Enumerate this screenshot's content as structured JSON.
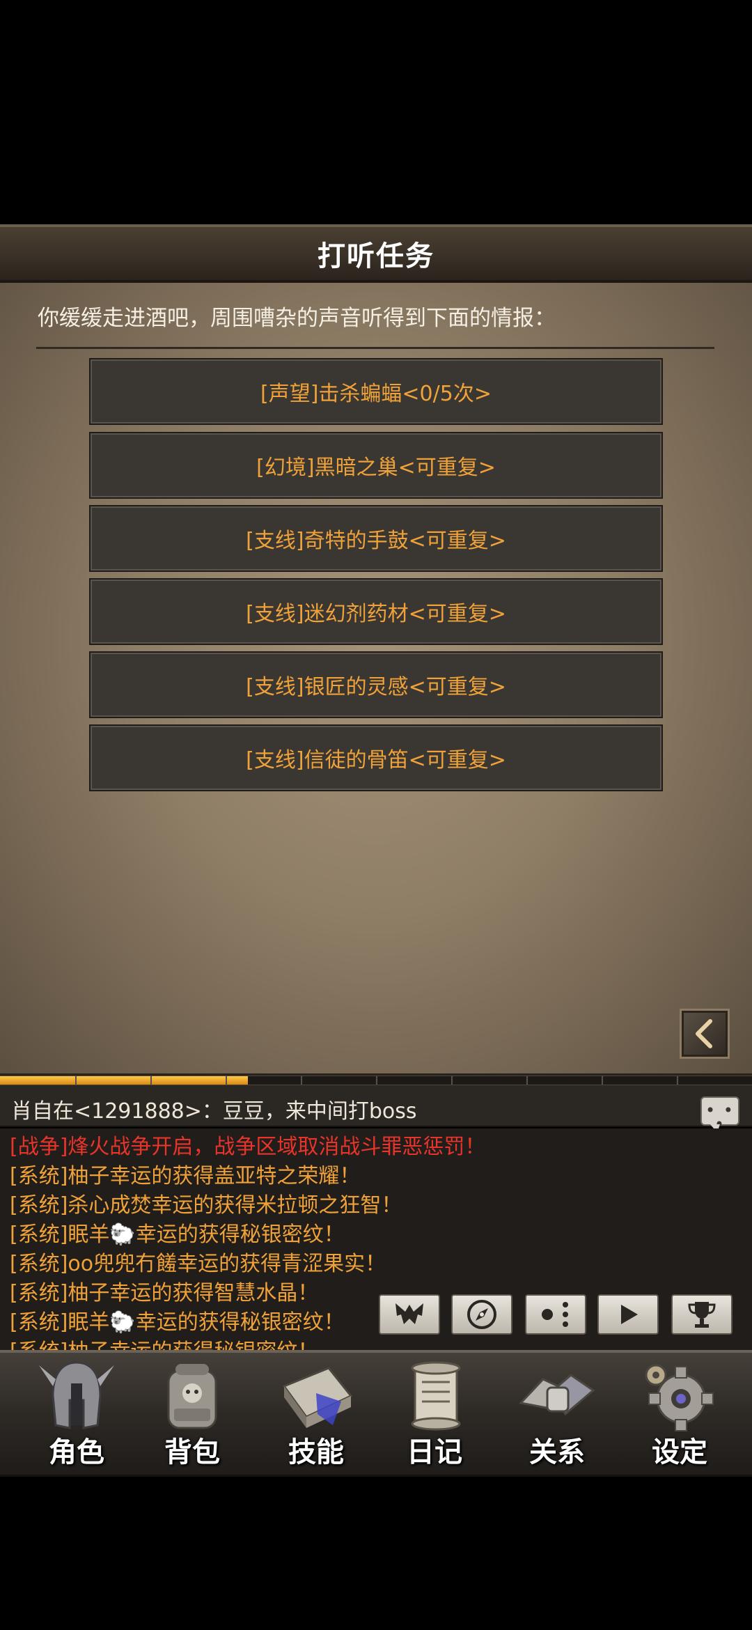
{
  "title": "打听任务",
  "intro": "你缓缓走进酒吧，周围嘈杂的声音听得到下面的情报：",
  "quests": [
    "[声望]击杀蝙蝠<0/5次>",
    "[幻境]黑暗之巢<可重复>",
    "[支线]奇特的手鼓<可重复>",
    "[支线]迷幻剂药材<可重复>",
    "[支线]银匠的灵感<可重复>",
    "[支线]信徒的骨笛<可重复>"
  ],
  "progress": {
    "fraction": 0.33
  },
  "chat": {
    "top_message": "肖自在<1291888>：豆豆，来中间打boss",
    "messages": [
      "[战争]烽火战争开启，战争区域取消战斗罪恶惩罚！",
      "[系统]柚子幸运的获得盖亚特之荣耀！",
      "[系统]杀心成焚幸运的获得米拉顿之狂智！",
      "[系统]眠羊🐑幸运的获得秘银密纹！",
      "[系统]oo兜兜冇饈幸运的获得青涩果实！",
      "[系统]柚子幸运的获得智慧水晶！",
      "[系统]眠羊🐑幸运的获得秘银密纹！",
      "[系统]柚子幸运的获得秘银密纹！"
    ],
    "controls": [
      "bat-icon",
      "compass-icon",
      "dots-icon",
      "play-icon",
      "trophy-icon"
    ]
  },
  "nav": [
    {
      "label": "角色",
      "icon": "helmet-icon"
    },
    {
      "label": "背包",
      "icon": "backpack-icon"
    },
    {
      "label": "技能",
      "icon": "spellbook-icon"
    },
    {
      "label": "日记",
      "icon": "scroll-icon"
    },
    {
      "label": "关系",
      "icon": "handshake-icon"
    },
    {
      "label": "设定",
      "icon": "gear-icon"
    }
  ],
  "colors": {
    "quest_text": "#f0a23a",
    "war_text": "#e8342a",
    "system_text": "#f0a23a"
  }
}
